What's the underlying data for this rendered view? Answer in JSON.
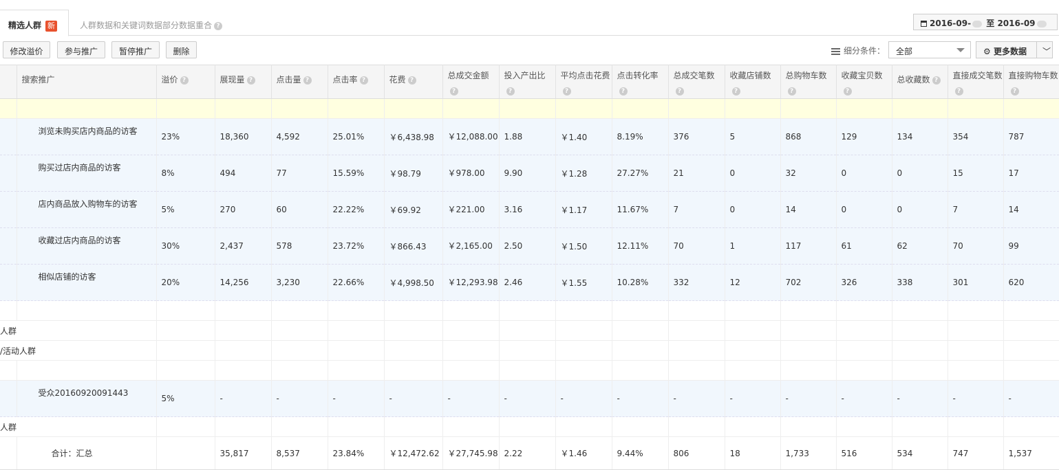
{
  "tabs": {
    "active_label": "精选人群",
    "new_badge": "新",
    "note": "人群数据和关键词数据部分数据重合"
  },
  "date_range": {
    "start": "2016-09-",
    "separator": "至",
    "end": "2016-09"
  },
  "toolbar": {
    "edit_bid": "修改溢价",
    "join": "参与推广",
    "pause": "暂停推广",
    "delete": "删除",
    "filter_label": "细分条件：",
    "filter_value": "全部",
    "more_data": "更多数据",
    "more_chevron": "﹀"
  },
  "columns": [
    "搜索推广",
    "溢价",
    "展现量",
    "点击量",
    "点击率",
    "花费",
    "总成交金额",
    "投入产出比",
    "平均点击花费",
    "点击转化率",
    "总成交笔数",
    "收藏店铺数",
    "总购物车数",
    "收藏宝贝数",
    "总收藏数",
    "直接成交笔数",
    "直接购物车数"
  ],
  "rows": [
    {
      "name": "浏览未购买店内商品的访客",
      "vals": [
        "23%",
        "18,360",
        "4,592",
        "25.01%",
        "￥6,438.98",
        "￥12,088.00",
        "1.88",
        "￥1.40",
        "8.19%",
        "376",
        "5",
        "868",
        "129",
        "134",
        "354",
        "787"
      ]
    },
    {
      "name": "购买过店内商品的访客",
      "vals": [
        "8%",
        "494",
        "77",
        "15.59%",
        "￥98.79",
        "￥978.00",
        "9.90",
        "￥1.28",
        "27.27%",
        "21",
        "0",
        "32",
        "0",
        "0",
        "15",
        "17"
      ]
    },
    {
      "name": "店内商品放入购物车的访客",
      "vals": [
        "5%",
        "270",
        "60",
        "22.22%",
        "￥69.92",
        "￥221.00",
        "3.16",
        "￥1.17",
        "11.67%",
        "7",
        "0",
        "14",
        "0",
        "0",
        "7",
        "14"
      ]
    },
    {
      "name": "收藏过店内商品的访客",
      "vals": [
        "30%",
        "2,437",
        "578",
        "23.72%",
        "￥866.43",
        "￥2,165.00",
        "2.50",
        "￥1.50",
        "12.11%",
        "70",
        "1",
        "117",
        "61",
        "62",
        "70",
        "99"
      ]
    },
    {
      "name": "相似店铺的访客",
      "vals": [
        "20%",
        "14,256",
        "3,230",
        "22.66%",
        "￥4,998.50",
        "￥12,293.98",
        "2.46",
        "￥1.55",
        "10.28%",
        "332",
        "12",
        "702",
        "326",
        "338",
        "301",
        "620"
      ]
    }
  ],
  "groups": {
    "g1": "人群",
    "g2": "/活动人群",
    "g3": "人群"
  },
  "audience_row": {
    "name": "受众20160920091443",
    "vals": [
      "5%",
      "-",
      "-",
      "-",
      "-",
      "-",
      "-",
      "-",
      "-",
      "-",
      "-",
      "-",
      "-",
      "-",
      "-",
      "-"
    ]
  },
  "total": {
    "label": "合计：汇总",
    "vals": [
      "35,817",
      "8,537",
      "23.84%",
      "￥12,472.62",
      "￥27,745.98",
      "2.22",
      "￥1.46",
      "9.44%",
      "806",
      "18",
      "1,733",
      "516",
      "534",
      "747",
      "1,537"
    ]
  }
}
